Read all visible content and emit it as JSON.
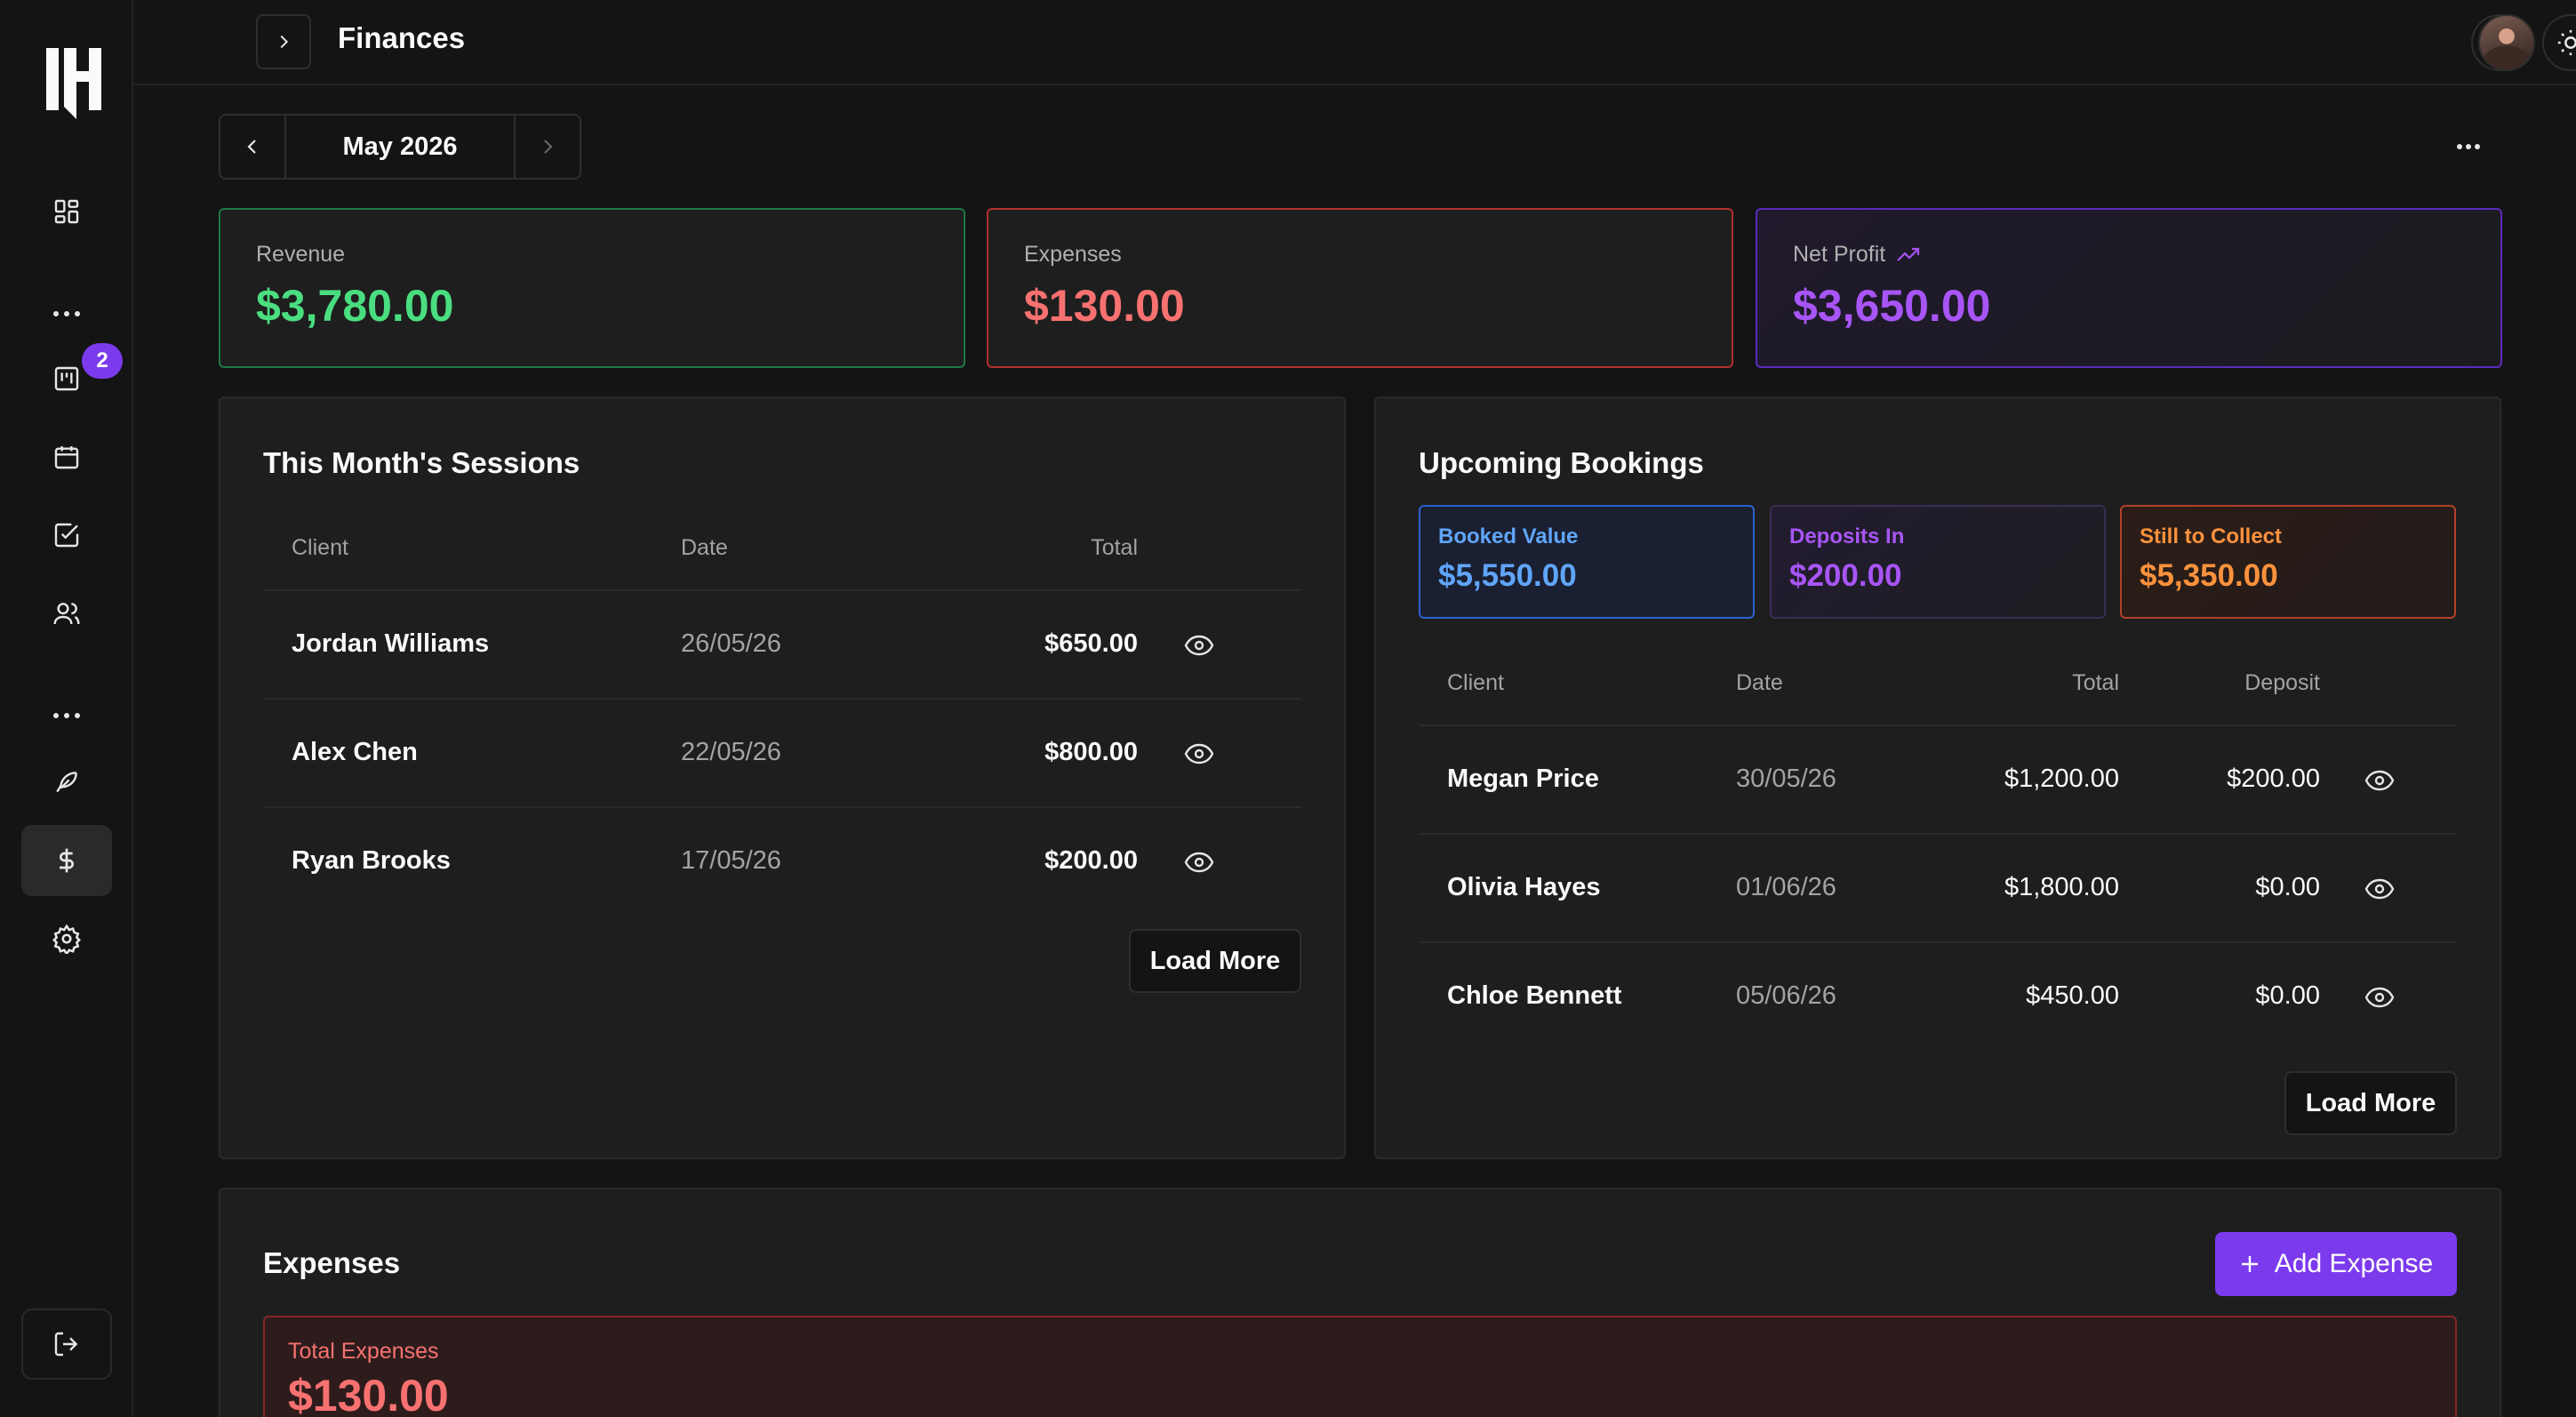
{
  "header": {
    "title": "Finances"
  },
  "sidebar": {
    "notification_count": "2"
  },
  "month_selector": {
    "label": "May 2026"
  },
  "stats": {
    "revenue": {
      "label": "Revenue",
      "value": "$3,780.00"
    },
    "expenses": {
      "label": "Expenses",
      "value": "$130.00"
    },
    "net_profit": {
      "label": "Net Profit",
      "value": "$3,650.00"
    }
  },
  "sessions": {
    "title": "This Month's Sessions",
    "columns": [
      "Client",
      "Date",
      "Total"
    ],
    "rows": [
      {
        "client": "Jordan Williams",
        "date": "26/05/26",
        "total": "$650.00"
      },
      {
        "client": "Alex Chen",
        "date": "22/05/26",
        "total": "$800.00"
      },
      {
        "client": "Ryan Brooks",
        "date": "17/05/26",
        "total": "$200.00"
      }
    ],
    "load_more": "Load More"
  },
  "bookings": {
    "title": "Upcoming Bookings",
    "summary": {
      "booked": {
        "label": "Booked Value",
        "value": "$5,550.00"
      },
      "deposits": {
        "label": "Deposits In",
        "value": "$200.00"
      },
      "still": {
        "label": "Still to Collect",
        "value": "$5,350.00"
      }
    },
    "columns": [
      "Client",
      "Date",
      "Total",
      "Deposit"
    ],
    "rows": [
      {
        "client": "Megan Price",
        "date": "30/05/26",
        "total": "$1,200.00",
        "deposit": "$200.00"
      },
      {
        "client": "Olivia Hayes",
        "date": "01/06/26",
        "total": "$1,800.00",
        "deposit": "$0.00"
      },
      {
        "client": "Chloe Bennett",
        "date": "05/06/26",
        "total": "$450.00",
        "deposit": "$0.00"
      }
    ],
    "load_more": "Load More"
  },
  "expenses_section": {
    "title": "Expenses",
    "add_button": "Add Expense",
    "total_label": "Total Expenses",
    "total_value": "$130.00"
  },
  "colors": {
    "revenue": "#4ade80",
    "expenses": "#f87171",
    "net_profit": "#a855f7",
    "booked": "#60a5fa",
    "still_to_collect": "#fb923c",
    "accent": "#7c3aed"
  },
  "icons": {
    "nav": [
      "dashboard-icon",
      "board-icon",
      "calendar-icon",
      "checkbox-icon",
      "users-icon",
      "feather-icon",
      "dollar-icon",
      "settings-icon",
      "logout-icon"
    ],
    "header": [
      "refresh-icon",
      "sun-icon"
    ]
  }
}
